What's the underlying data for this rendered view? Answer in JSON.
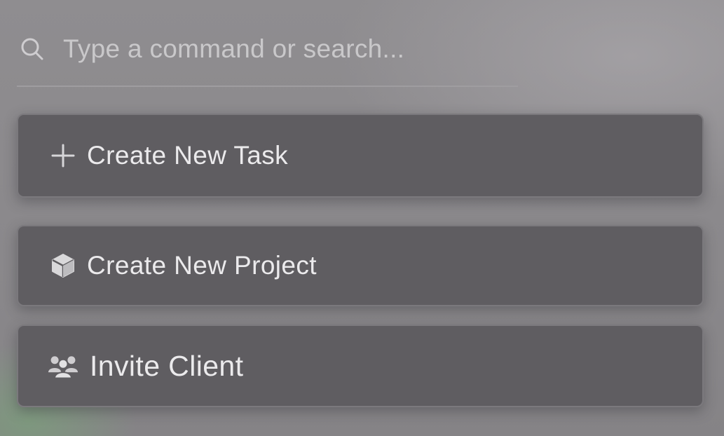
{
  "search": {
    "placeholder": "Type a command or search...",
    "icon": "search-icon"
  },
  "actions": [
    {
      "label": "Create New Task",
      "icon": "plus-icon"
    },
    {
      "label": "Create New Project",
      "icon": "cube-icon"
    },
    {
      "label": "Invite Client",
      "icon": "users-icon"
    }
  ],
  "colors": {
    "background": "#8c8a8d",
    "item_background": "#5f5d61",
    "item_border": "#7b797d",
    "text": "#ebeaec",
    "placeholder": "#c9c8ca",
    "accent_glow": "#78aa78"
  }
}
